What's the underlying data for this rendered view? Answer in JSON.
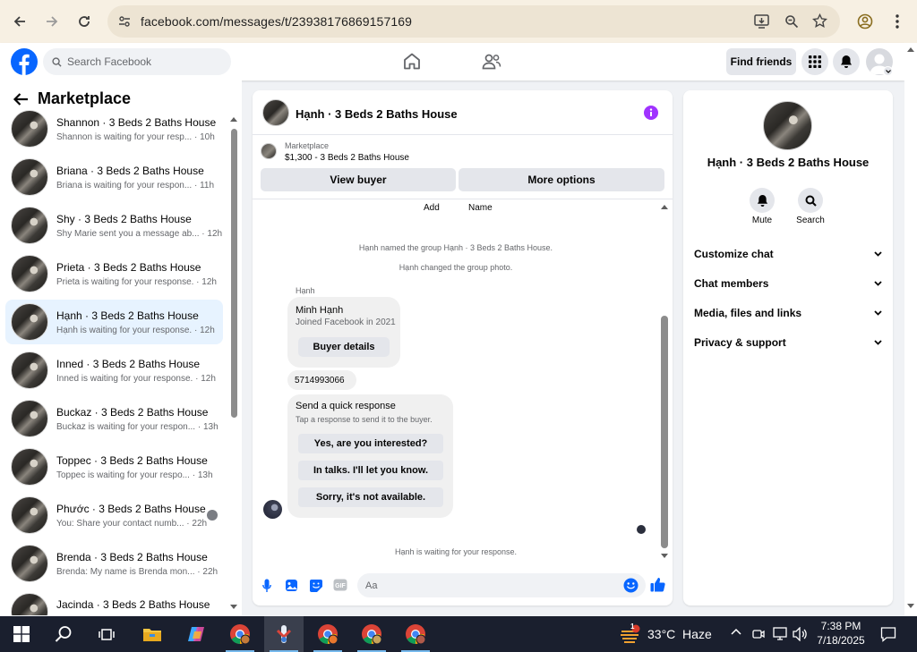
{
  "browser": {
    "url": "facebook.com/messages/t/23938176869157169"
  },
  "header": {
    "search_placeholder": "Search Facebook",
    "find_friends": "Find friends"
  },
  "sidebar": {
    "title": "Marketplace",
    "items": [
      {
        "name": "Shannon · 3 Beds 2 Baths House",
        "sub": "Shannon is waiting for your resp... · 10h"
      },
      {
        "name": "Briana · 3 Beds 2 Baths House",
        "sub": "Briana is waiting for your respon... · 11h"
      },
      {
        "name": "Shy · 3 Beds 2 Baths House",
        "sub": "Shy Marie sent you a message ab... · 12h"
      },
      {
        "name": "Prieta · 3 Beds 2 Baths House",
        "sub": "Prieta is waiting for your response. · 12h"
      },
      {
        "name": "Hạnh · 3 Beds 2 Baths House",
        "sub": "Hạnh is waiting for your response. · 12h"
      },
      {
        "name": "Inned · 3 Beds 2 Baths House",
        "sub": "Inned is waiting for your response. · 12h"
      },
      {
        "name": "Buckaz · 3 Beds 2 Baths House",
        "sub": "Buckaz is waiting for your respon... · 13h"
      },
      {
        "name": "Toppec · 3 Beds 2 Baths House",
        "sub": "Toppec is waiting for your respo... · 13h"
      },
      {
        "name": "Phước · 3 Beds 2 Baths House",
        "sub": "You: Share your contact numb... · 22h"
      },
      {
        "name": "Brenda · 3 Beds 2 Baths House",
        "sub": "Brenda: My name is Brenda mon... · 22h"
      },
      {
        "name": "Jacinda · 3 Beds 2 Baths House",
        "sub": ""
      }
    ]
  },
  "chat": {
    "title": "Hạnh · 3 Beds 2 Baths House",
    "listing_source": "Marketplace",
    "listing_price_title": "$1,300 - 3 Beds 2 Baths House",
    "view_buyer": "View buyer",
    "more_options": "More options",
    "col_add": "Add",
    "col_name": "Name",
    "sys1": "Hạnh named the group Hạnh · 3 Beds 2 Baths House.",
    "sys2": "Hạnh changed the group photo.",
    "sender": "Hạnh",
    "card_name": "Minh Hạnh",
    "card_sub": "Joined Facebook in 2021",
    "buyer_details": "Buyer details",
    "phone": "5714993066",
    "qr_title": "Send a quick response",
    "qr_sub": "Tap a response to send it to the buyer.",
    "quick_replies": [
      "Yes, are you interested?",
      "In talks. I'll let you know.",
      "Sorry, it's not available."
    ],
    "waiting": "Hạnh is waiting for your response.",
    "composer_placeholder": "Aa"
  },
  "details": {
    "title": "Hạnh · 3 Beds 2 Baths House",
    "mute": "Mute",
    "search": "Search",
    "sections": [
      "Customize chat",
      "Chat members",
      "Media, files and links",
      "Privacy & support"
    ]
  },
  "taskbar": {
    "weather": "33°C  Haze",
    "time": "7:38 PM",
    "date": "7/18/2025",
    "badge": "1"
  },
  "colors": {
    "fb_blue": "#0866ff",
    "messenger_purple": "#a033ff",
    "selected_row": "#e7f3ff"
  }
}
